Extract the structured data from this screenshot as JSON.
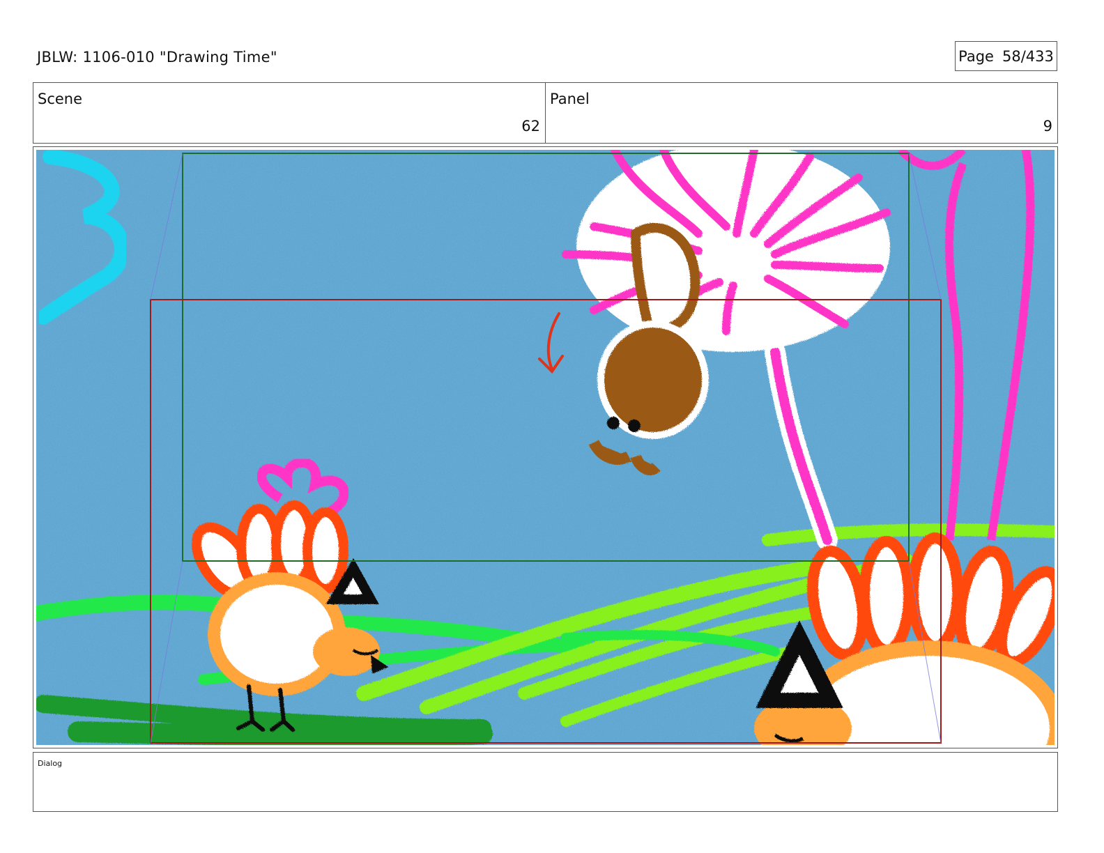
{
  "header": {
    "title": "JBLW: 1106-010 \"Drawing Time\"",
    "page_label": "Page",
    "page_number": "58/433"
  },
  "info": {
    "scene_label": "Scene",
    "scene_value": "62",
    "panel_label": "Panel",
    "panel_value": "9"
  },
  "panel": {
    "background_color": "#5aa3cf",
    "safe_frame_color": "#1f6b2a",
    "camera_frame_color": "#a01818",
    "motion_arrow_color": "#e0331a"
  },
  "dialog": {
    "label": "Dialog",
    "text": ""
  }
}
